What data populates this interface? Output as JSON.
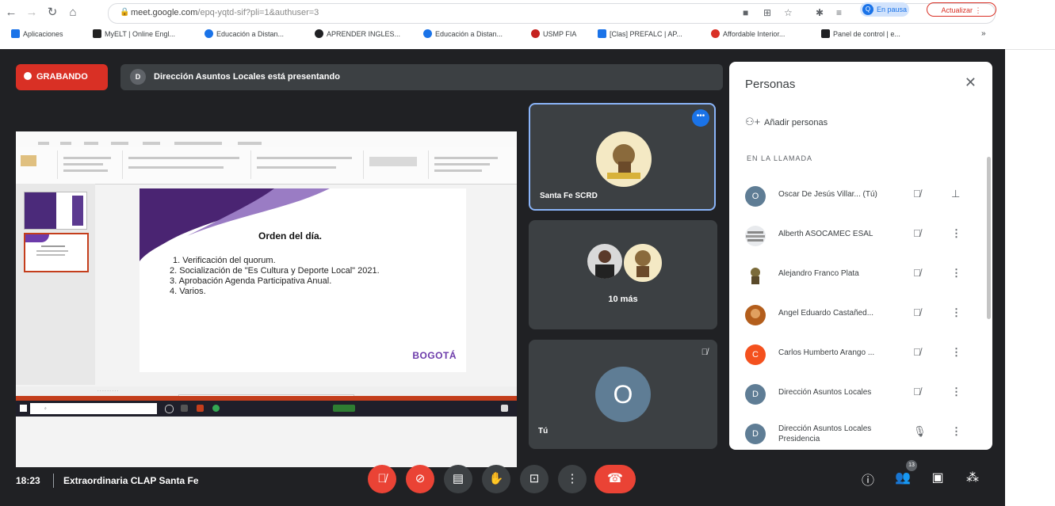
{
  "browser": {
    "url_host": "meet.google.com",
    "url_path": "/epq-yqtd-sif?pli=1&authuser=3",
    "profile_initial": "Q",
    "profile_label": "En pausa",
    "update_label": "Actualizar",
    "bookmarks": [
      {
        "label": "Aplicaciones",
        "color": "#1a73e8"
      },
      {
        "label": "MyELT | Online Engl...",
        "color": "#222222"
      },
      {
        "label": "Educación a Distan...",
        "color": "#1a73e8"
      },
      {
        "label": "APRENDER INGLES...",
        "color": "#202124"
      },
      {
        "label": "Educación a Distan...",
        "color": "#1a73e8"
      },
      {
        "label": "USMP FIA",
        "color": "#c5221f"
      },
      {
        "label": "[Clas] PREFALC | AP...",
        "color": "#1a73e8"
      },
      {
        "label": "Affordable Interior...",
        "color": "#d93025"
      },
      {
        "label": "Panel de control | e...",
        "color": "#202124"
      }
    ]
  },
  "meet": {
    "recording_label": "GRABANDO",
    "presenter_initial": "D",
    "presenting_text": "Dirección Asuntos Locales está presentando",
    "slide": {
      "title": "Orden del día.",
      "items": [
        "1.  Verificación del quorum.",
        "2. Socialización de \"Es Cultura y Deporte Local\" 2021.",
        "3. Aprobación Agenda Participativa Anual.",
        "4. Varios."
      ],
      "logo": "BOGOTÁ"
    },
    "tiles": {
      "santa_fe_name": "Santa Fe SCRD",
      "more_label": "10 más",
      "self_initial": "O",
      "self_label": "Tú"
    },
    "people_panel": {
      "title": "Personas",
      "add_label": "Añadir personas",
      "section": "EN LA LLAMADA",
      "participants": [
        {
          "name": "Oscar De Jesús Villar...  (Tú)",
          "initial": "O",
          "color": "#5f7d95"
        },
        {
          "name": "Alberth ASOCAMEC ESAL",
          "initial": "",
          "color": "#9aa0a6"
        },
        {
          "name": "Alejandro Franco Plata",
          "initial": "",
          "color": "#7b6b3a"
        },
        {
          "name": "Angel Eduardo Castañed...",
          "initial": "",
          "color": "#b35e1c"
        },
        {
          "name": "Carlos Humberto Arango ...",
          "initial": "C",
          "color": "#f4511e"
        },
        {
          "name": "Dirección Asuntos Locales",
          "initial": "D",
          "color": "#5f7d95"
        },
        {
          "name": "Dirección Asuntos Locales Presidencia",
          "initial": "D",
          "color": "#5f7d95"
        }
      ]
    },
    "bottom": {
      "time": "18:23",
      "meeting_name": "Extraordinaria CLAP Santa Fe",
      "participant_count": "13"
    }
  }
}
